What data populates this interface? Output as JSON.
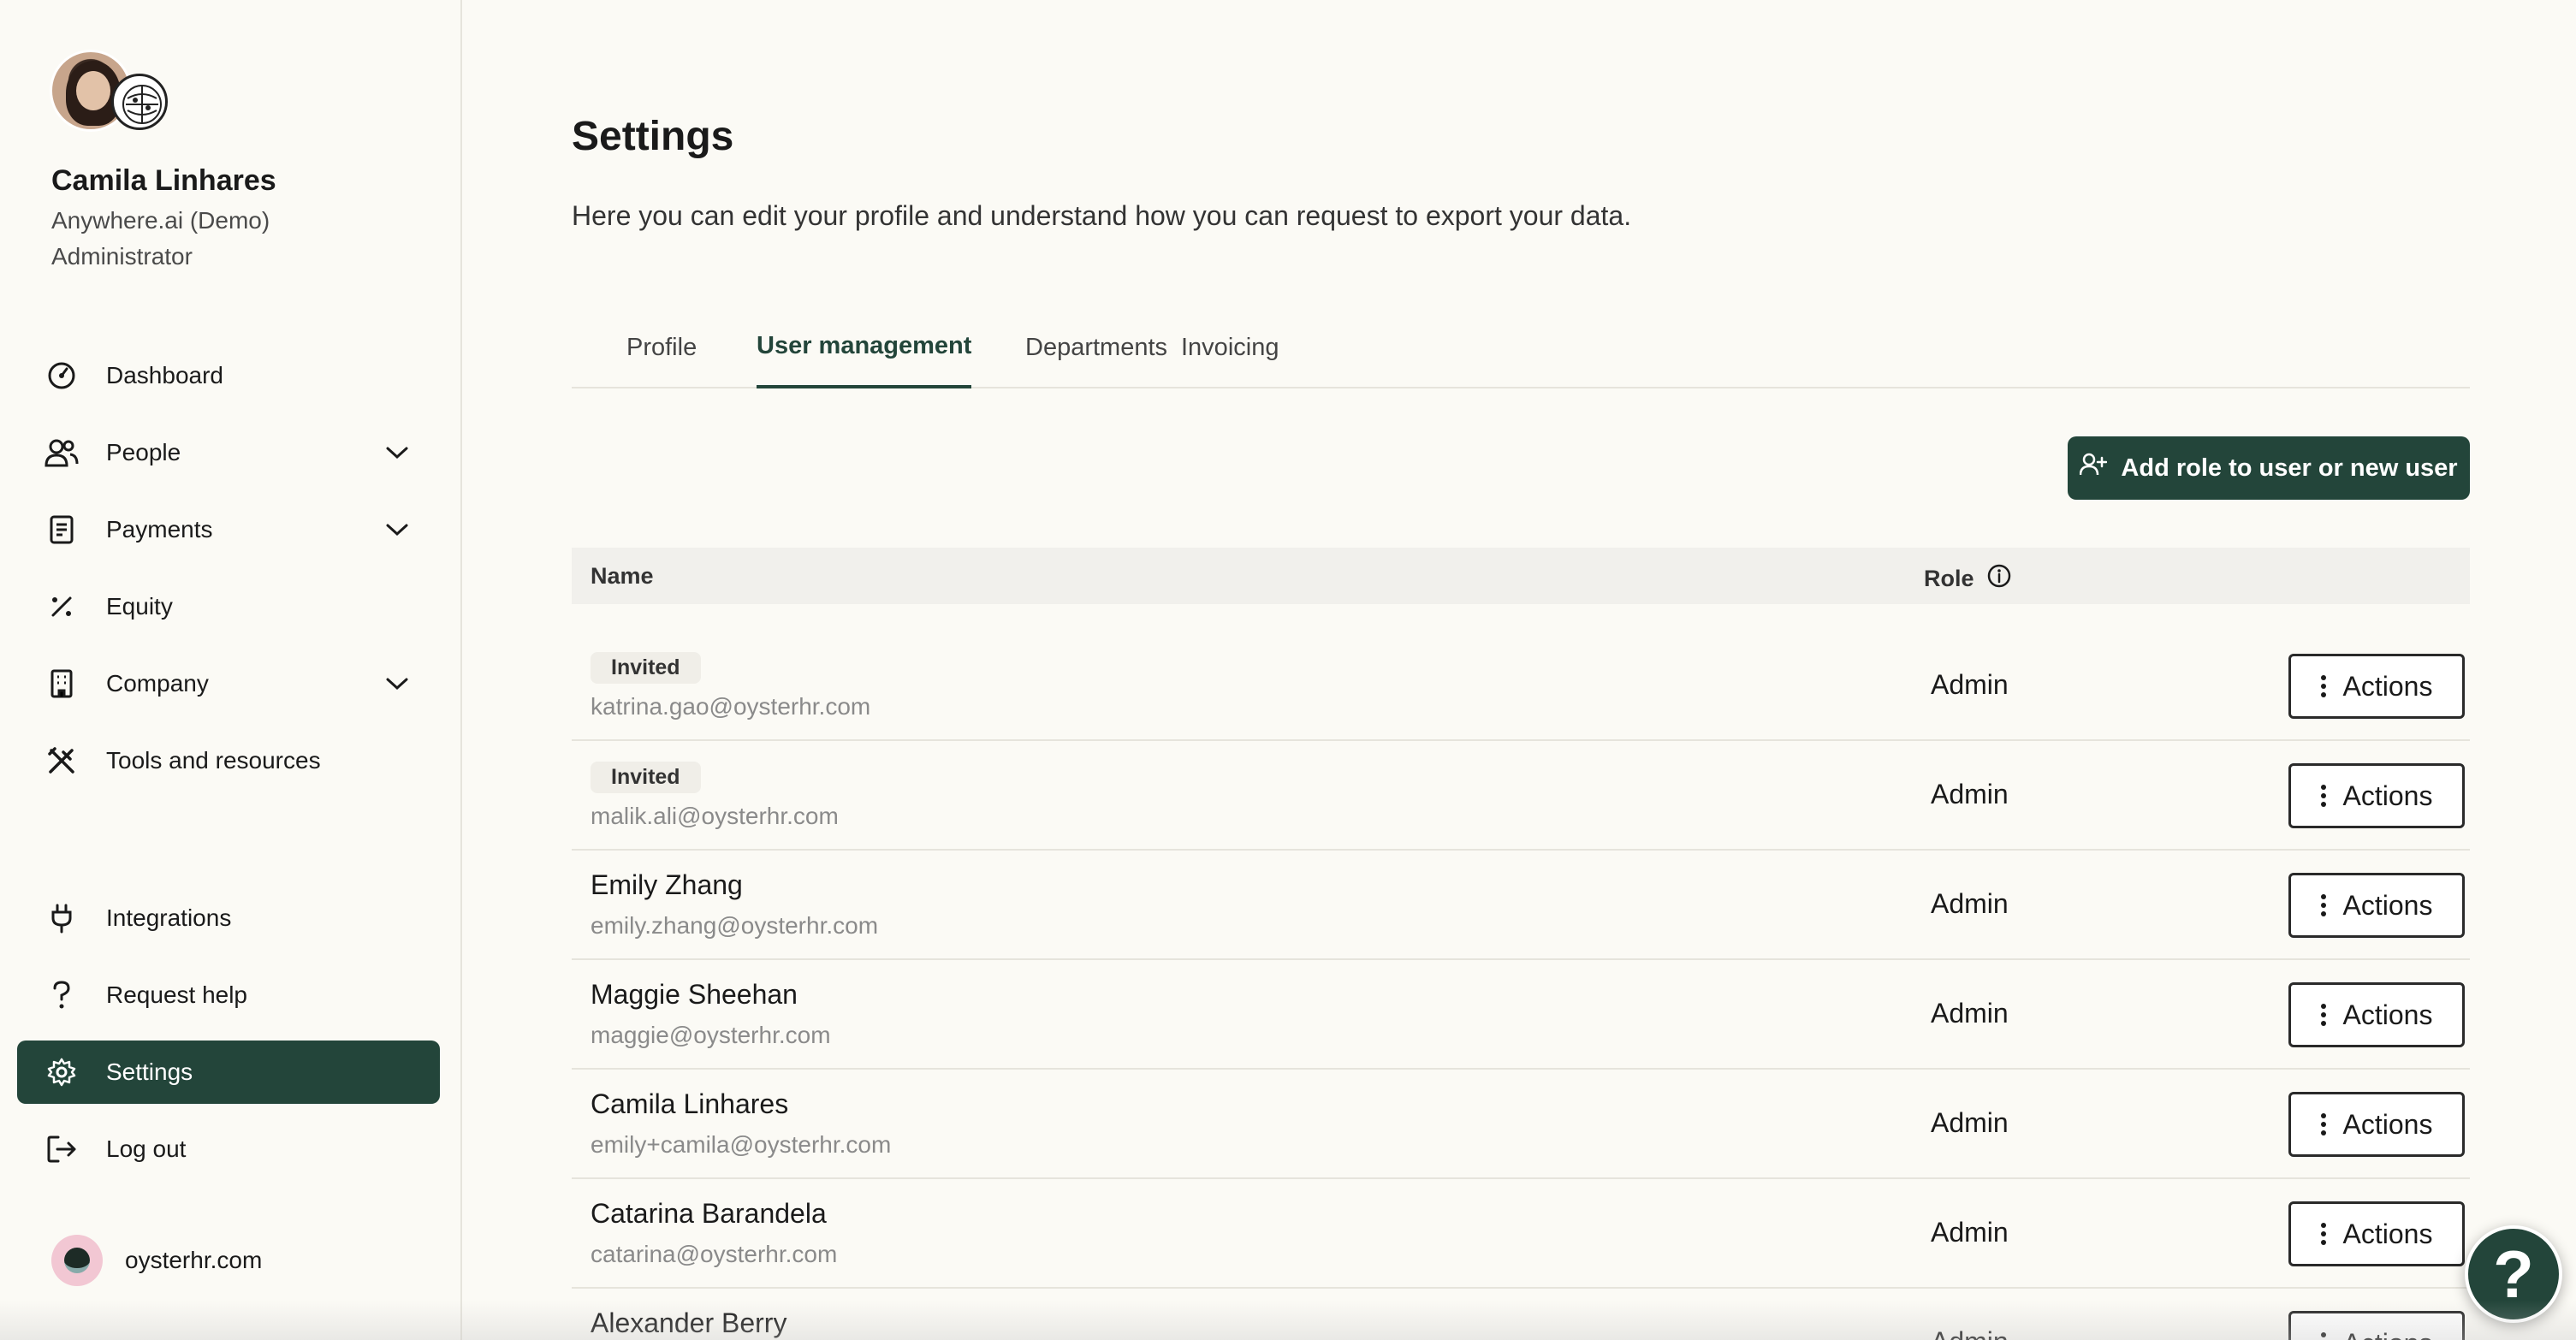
{
  "user": {
    "name": "Camila Linhares",
    "org": "Anywhere.ai (Demo)",
    "role": "Administrator"
  },
  "nav": {
    "items": [
      {
        "label": "Dashboard",
        "icon": "dashboard-icon"
      },
      {
        "label": "People",
        "icon": "people-icon",
        "expandable": true
      },
      {
        "label": "Payments",
        "icon": "payments-icon",
        "expandable": true
      },
      {
        "label": "Equity",
        "icon": "equity-icon"
      },
      {
        "label": "Company",
        "icon": "company-icon",
        "expandable": true
      },
      {
        "label": "Tools and resources",
        "icon": "tools-icon"
      }
    ],
    "bottom_items": [
      {
        "label": "Integrations",
        "icon": "plug-icon"
      },
      {
        "label": "Request help",
        "icon": "question-icon"
      },
      {
        "label": "Settings",
        "icon": "gear-icon",
        "active": true
      },
      {
        "label": "Log out",
        "icon": "logout-icon"
      }
    ],
    "footer_org": "oysterhr.com"
  },
  "page": {
    "title": "Settings",
    "description": "Here you can edit your profile and understand how you can request to export your data."
  },
  "tabs": [
    {
      "label": "Profile"
    },
    {
      "label": "User management",
      "active": true
    },
    {
      "label": "Departments"
    },
    {
      "label": "Invoicing"
    }
  ],
  "add_button_label": "Add role to user or new user",
  "table": {
    "headers": {
      "name": "Name",
      "role": "Role"
    },
    "action_label": "Actions",
    "rows": [
      {
        "badge": "Invited",
        "name": "",
        "email": "katrina.gao@oysterhr.com",
        "role": "Admin"
      },
      {
        "badge": "Invited",
        "name": "",
        "email": "malik.ali@oysterhr.com",
        "role": "Admin"
      },
      {
        "badge": "",
        "name": "Emily Zhang",
        "email": "emily.zhang@oysterhr.com",
        "role": "Admin"
      },
      {
        "badge": "",
        "name": "Maggie Sheehan",
        "email": "maggie@oysterhr.com",
        "role": "Admin"
      },
      {
        "badge": "",
        "name": "Camila Linhares",
        "email": "emily+camila@oysterhr.com",
        "role": "Admin"
      },
      {
        "badge": "",
        "name": "Catarina Barandela",
        "email": "catarina@oysterhr.com",
        "role": "Admin"
      },
      {
        "badge": "",
        "name": "Alexander Berry",
        "email": "",
        "role": "Admin"
      }
    ]
  },
  "help_fab_label": "?",
  "colors": {
    "brand": "#23453a",
    "background": "#fbfaf5",
    "badge_bg": "#f0eee8"
  }
}
